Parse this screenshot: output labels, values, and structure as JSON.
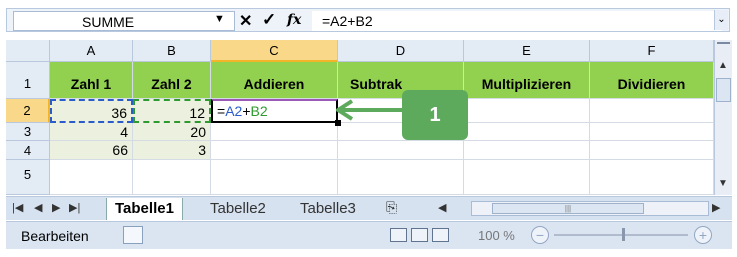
{
  "formula_bar": {
    "name_box": "SUMME",
    "cancel_symbol": "✕",
    "enter_symbol": "✓",
    "fx_label": "fx",
    "formula": "=A2+B2"
  },
  "columns": [
    "A",
    "B",
    "C",
    "D",
    "E",
    "F"
  ],
  "rows": [
    "1",
    "2",
    "3",
    "4",
    "5"
  ],
  "headers": {
    "a1": "Zahl 1",
    "b1": "Zahl 2",
    "c1": "Addieren",
    "d1": "Subtrak",
    "e1": "Multiplizieren",
    "f1": "Dividieren"
  },
  "data": {
    "a2": "36",
    "b2": "12",
    "a3": "4",
    "b3": "20",
    "a4": "66",
    "b4": "3"
  },
  "active_cell_formula": {
    "prefix": "=",
    "ref_a": "A2",
    "op": "+",
    "ref_b": "B2"
  },
  "sheet_tabs": [
    "Tabelle1",
    "Tabelle2",
    "Tabelle3"
  ],
  "status": {
    "mode": "Bearbeiten",
    "zoom": "100 %"
  },
  "callout": {
    "label": "1",
    "color": "#5daa5d"
  },
  "colors": {
    "header_green": "#92d050",
    "ref_blue": "#2b5ccc",
    "ref_green": "#2f9a2f",
    "selected_header": "#f9d989"
  }
}
